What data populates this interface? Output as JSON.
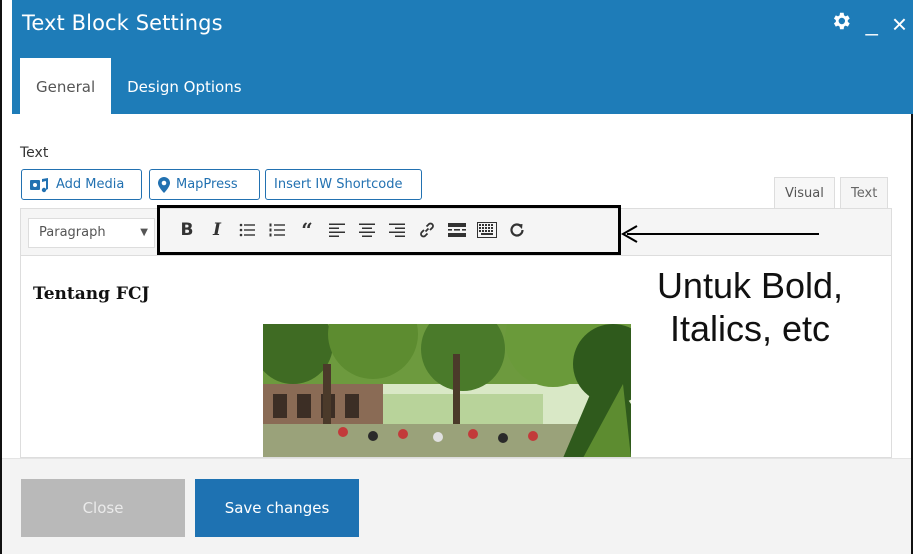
{
  "dialog": {
    "title": "Text Block Settings",
    "icons": [
      "gear-icon",
      "minimize-icon",
      "close-icon"
    ],
    "minimize_glyph": "_",
    "close_glyph": "×"
  },
  "tabs": [
    {
      "label": "General",
      "active": true
    },
    {
      "label": "Design Options",
      "active": false
    }
  ],
  "field": {
    "label": "Text"
  },
  "media_buttons": {
    "add_media": "Add Media",
    "mappress": "MapPress",
    "shortcode": "Insert IW Shortcode"
  },
  "editor_modes": {
    "visual": "Visual",
    "text": "Text"
  },
  "toolbar": {
    "format_value": "Paragraph",
    "buttons": [
      "bold-icon",
      "italic-icon",
      "bullet-list-icon",
      "numbered-list-icon",
      "blockquote-icon",
      "align-left-icon",
      "align-center-icon",
      "align-right-icon",
      "link-icon",
      "read-more-icon",
      "toolbar-toggle-icon",
      "undo-icon"
    ],
    "bold_glyph": "B",
    "italic_glyph": "I",
    "quote_glyph": "“"
  },
  "content": {
    "heading": "Tentang FCJ"
  },
  "annotation": {
    "line1": "Untuk Bold,",
    "line2": "Italics, etc"
  },
  "footer": {
    "close_label": "Close",
    "save_label": "Save changes"
  },
  "colors": {
    "header_bg": "#1e7cb8",
    "save_bg": "#1e72b2",
    "close_bg": "#b9b9b9",
    "link_blue": "#2271b1"
  }
}
